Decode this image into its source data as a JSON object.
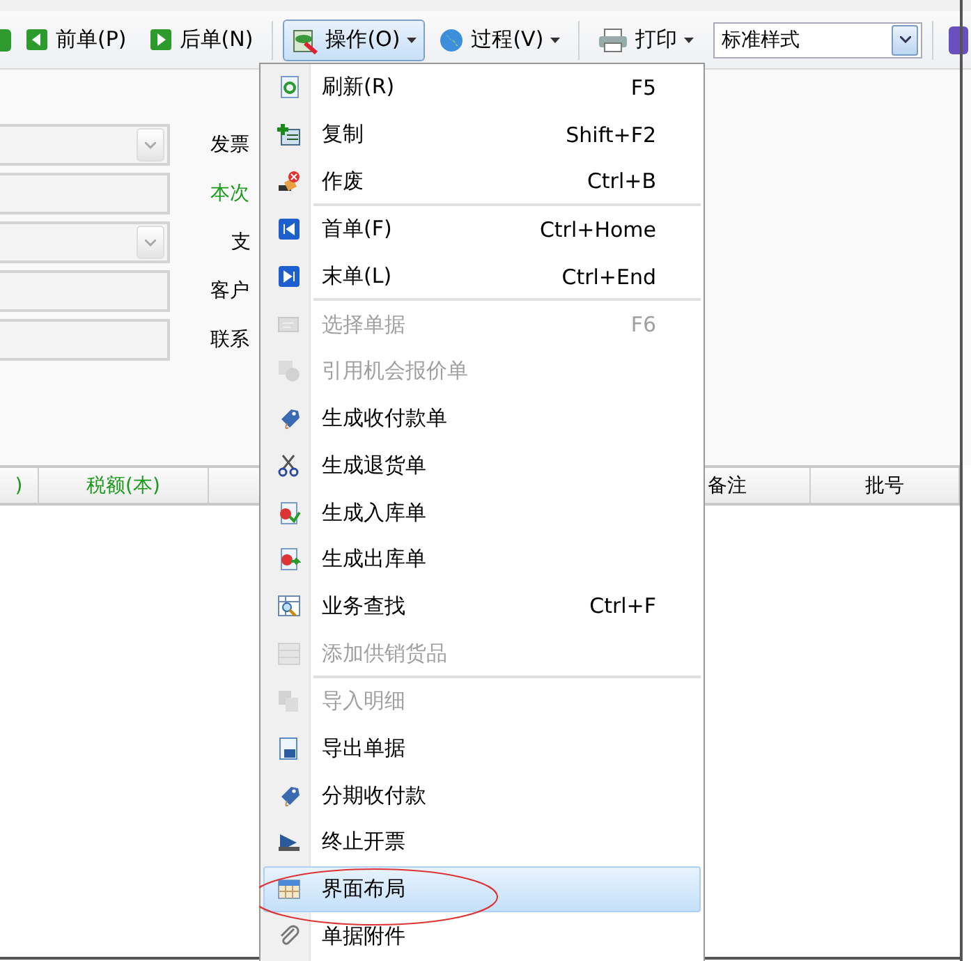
{
  "toolbar": {
    "items": [
      {
        "kind": "button",
        "label": "前单(P)"
      },
      {
        "kind": "button",
        "label": "后单(N)"
      },
      {
        "kind": "separator"
      },
      {
        "kind": "menu",
        "label": "操作(O)",
        "selected": true
      },
      {
        "kind": "menu",
        "label": "过程(V)",
        "selected": false
      },
      {
        "kind": "separator"
      },
      {
        "kind": "menu",
        "label": "打印",
        "selected": false
      },
      {
        "kind": "combo",
        "value": "标准样式"
      },
      {
        "kind": "separator"
      }
    ]
  },
  "form": {
    "fields": [
      {
        "kind": "dropdown"
      },
      {
        "kind": "text"
      },
      {
        "kind": "dropdown"
      },
      {
        "kind": "text"
      },
      {
        "kind": "text"
      }
    ],
    "labels": [
      {
        "text": "发票",
        "color": "#000000"
      },
      {
        "text": "本次",
        "color": "#1a9a1a"
      },
      {
        "text": "支",
        "color": "#000000"
      },
      {
        "text": "客户",
        "color": "#000000"
      },
      {
        "text": "联系",
        "color": "#000000"
      }
    ]
  },
  "grid": {
    "columns": [
      {
        "label": ")",
        "color": "#1a9a1a"
      },
      {
        "label": "税额(本)",
        "color": "#1a9a1a"
      },
      {
        "label": "备注",
        "color": "#000000"
      },
      {
        "label": "批号",
        "color": "#000000"
      }
    ]
  },
  "menu": {
    "items": [
      {
        "kind": "item",
        "label": "刷新(R)",
        "shortcut": "F5",
        "disabled": false,
        "selected": false
      },
      {
        "kind": "item",
        "label": "复制",
        "shortcut": "Shift+F2",
        "disabled": false,
        "selected": false
      },
      {
        "kind": "item",
        "label": "作废",
        "shortcut": "Ctrl+B",
        "disabled": false,
        "selected": false
      },
      {
        "kind": "separator"
      },
      {
        "kind": "item",
        "label": "首单(F)",
        "shortcut": "Ctrl+Home",
        "disabled": false,
        "selected": false
      },
      {
        "kind": "item",
        "label": "末单(L)",
        "shortcut": "Ctrl+End",
        "disabled": false,
        "selected": false
      },
      {
        "kind": "separator"
      },
      {
        "kind": "item",
        "label": "选择单据",
        "shortcut": "F6",
        "disabled": true,
        "selected": false
      },
      {
        "kind": "item",
        "label": "引用机会报价单",
        "disabled": true,
        "selected": false
      },
      {
        "kind": "item",
        "label": "生成收付款单",
        "disabled": false,
        "selected": false
      },
      {
        "kind": "item",
        "label": "生成退货单",
        "disabled": false,
        "selected": false
      },
      {
        "kind": "item",
        "label": "生成入库单",
        "disabled": false,
        "selected": false
      },
      {
        "kind": "item",
        "label": "生成出库单",
        "disabled": false,
        "selected": false
      },
      {
        "kind": "item",
        "label": "业务查找",
        "shortcut": "Ctrl+F",
        "disabled": false,
        "selected": false
      },
      {
        "kind": "item",
        "label": "添加供销货品",
        "disabled": true,
        "selected": false
      },
      {
        "kind": "separator"
      },
      {
        "kind": "item",
        "label": "导入明细",
        "disabled": true,
        "selected": false
      },
      {
        "kind": "item",
        "label": "导出单据",
        "disabled": false,
        "selected": false
      },
      {
        "kind": "item",
        "label": "分期收付款",
        "disabled": false,
        "selected": false
      },
      {
        "kind": "item",
        "label": "终止开票",
        "disabled": false,
        "selected": false
      },
      {
        "kind": "item",
        "label": "界面布局",
        "disabled": false,
        "selected": true
      },
      {
        "kind": "item",
        "label": "单据附件",
        "disabled": false,
        "selected": false
      }
    ]
  }
}
